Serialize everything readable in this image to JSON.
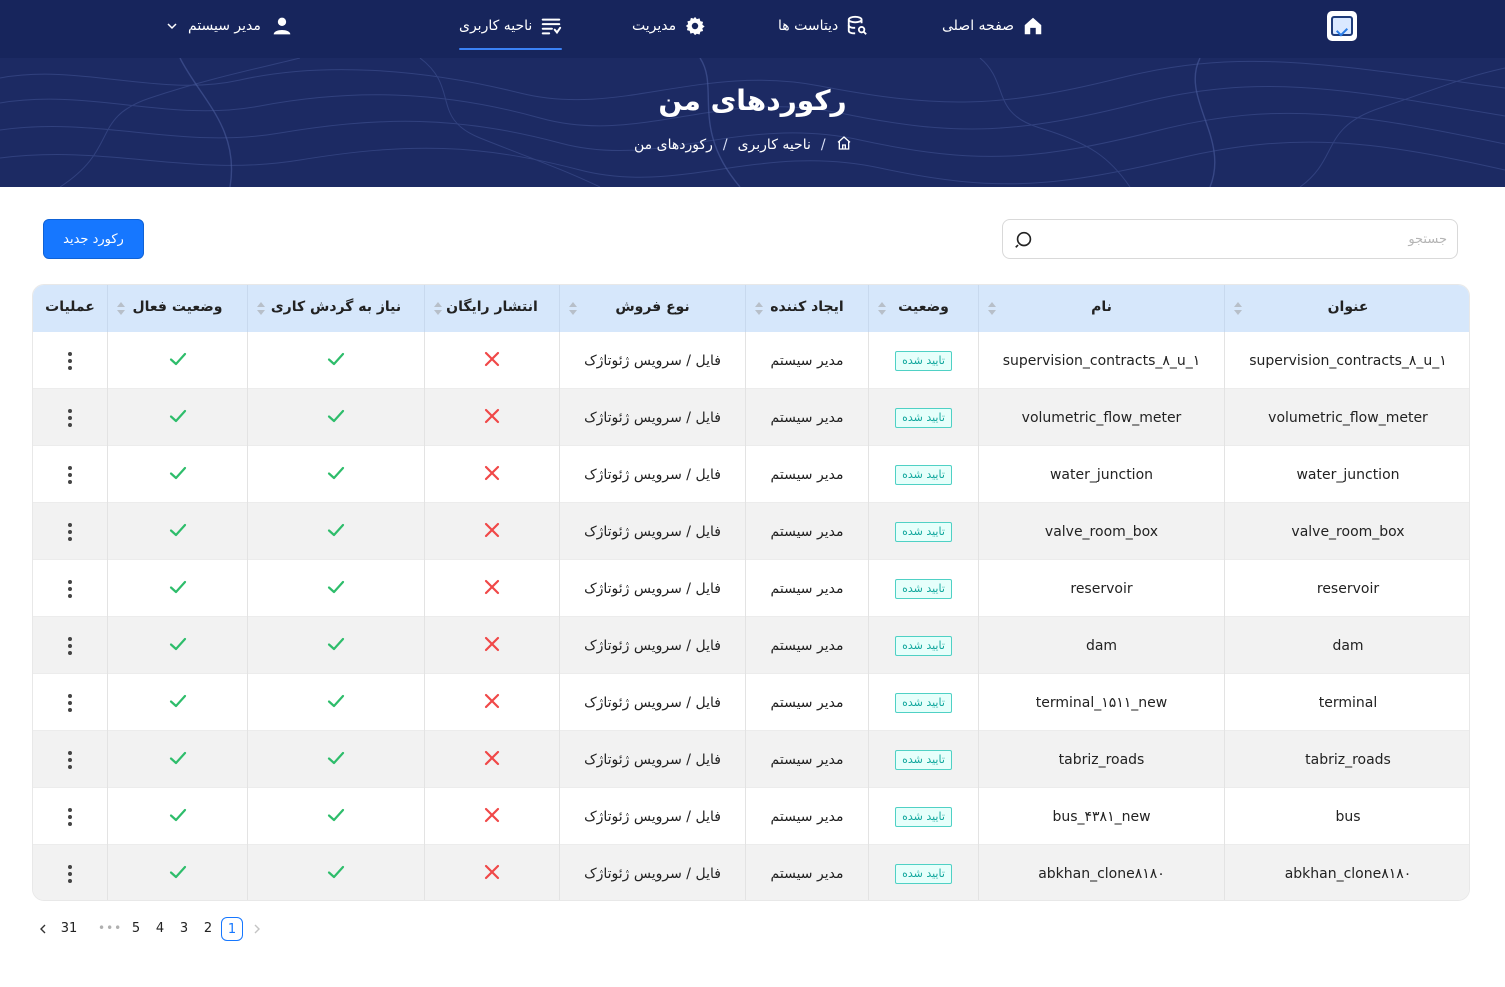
{
  "nav": {
    "home": "صفحه اصلی",
    "datasets": "دیتاست ها",
    "admin": "مدیریت",
    "user_area": "ناحیه کاربری",
    "profile": "مدیر سیستم"
  },
  "banner": {
    "title": "رکوردهای من",
    "breadcrumb": [
      "ناحیه کاربری",
      "رکوردهای من"
    ],
    "separator": "/"
  },
  "toolbar": {
    "search_placeholder": "جستجو",
    "new_record": "رکورد جدید"
  },
  "table": {
    "columns": [
      "عنوان",
      "نام",
      "وضعیت",
      "ایجاد کننده",
      "نوع فروش",
      "انتشار رایگان",
      "نیاز به گردش کاری",
      "وضعیت فعال",
      "عملیات"
    ],
    "rows": [
      {
        "title": "supervision_contracts_۸_u_۱",
        "name": "supervision_contracts_۸_u_۱",
        "status": "تایید شده",
        "creator": "مدیر سیستم",
        "sale_type": "فایل / سرویس ژئوتاژک",
        "free": false,
        "workflow": true,
        "active": true
      },
      {
        "title": "volumetric_flow_meter",
        "name": "volumetric_flow_meter",
        "status": "تایید شده",
        "creator": "مدیر سیستم",
        "sale_type": "فایل / سرویس ژئوتاژک",
        "free": false,
        "workflow": true,
        "active": true
      },
      {
        "title": "water_junction",
        "name": "water_junction",
        "status": "تایید شده",
        "creator": "مدیر سیستم",
        "sale_type": "فایل / سرویس ژئوتاژک",
        "free": false,
        "workflow": true,
        "active": true
      },
      {
        "title": "valve_room_box",
        "name": "valve_room_box",
        "status": "تایید شده",
        "creator": "مدیر سیستم",
        "sale_type": "فایل / سرویس ژئوتاژک",
        "free": false,
        "workflow": true,
        "active": true
      },
      {
        "title": "reservoir",
        "name": "reservoir",
        "status": "تایید شده",
        "creator": "مدیر سیستم",
        "sale_type": "فایل / سرویس ژئوتاژک",
        "free": false,
        "workflow": true,
        "active": true
      },
      {
        "title": "dam",
        "name": "dam",
        "status": "تایید شده",
        "creator": "مدیر سیستم",
        "sale_type": "فایل / سرویس ژئوتاژک",
        "free": false,
        "workflow": true,
        "active": true
      },
      {
        "title": "terminal",
        "name": "terminal_۱۵۱۱_new",
        "status": "تایید شده",
        "creator": "مدیر سیستم",
        "sale_type": "فایل / سرویس ژئوتاژک",
        "free": false,
        "workflow": true,
        "active": true
      },
      {
        "title": "tabriz_roads",
        "name": "tabriz_roads",
        "status": "تایید شده",
        "creator": "مدیر سیستم",
        "sale_type": "فایل / سرویس ژئوتاژک",
        "free": false,
        "workflow": true,
        "active": true
      },
      {
        "title": "bus",
        "name": "bus_۴۳۸۱_new",
        "status": "تایید شده",
        "creator": "مدیر سیستم",
        "sale_type": "فایل / سرویس ژئوتاژک",
        "free": false,
        "workflow": true,
        "active": true
      },
      {
        "title": "abkhan_clone۸۱۸۰",
        "name": "abkhan_clone۸۱۸۰",
        "status": "تایید شده",
        "creator": "مدیر سیستم",
        "sale_type": "فایل / سرویس ژئوتاژک",
        "free": false,
        "workflow": true,
        "active": true
      }
    ]
  },
  "pagination": {
    "current": "1",
    "pages": [
      "1",
      "2",
      "3",
      "4",
      "5"
    ],
    "last": "31",
    "ellipsis": "•••"
  },
  "colors": {
    "nav_bg": "#17255c",
    "banner_bg": "#1c2a63",
    "header_bg": "#d6e7fb",
    "primary": "#1677ff",
    "check": "#2ebd6b",
    "cross": "#f04848",
    "tag": "#13a89e"
  },
  "icons": {
    "home": "home-icon",
    "datasets": "database-search-icon",
    "admin": "gear-icon",
    "user_area": "list-filter-icon",
    "profile": "user-icon",
    "dropdown": "chevron-down-icon",
    "search": "search-icon",
    "yes": "check-icon",
    "no": "cross-icon",
    "menu": "more-vertical-icon"
  }
}
